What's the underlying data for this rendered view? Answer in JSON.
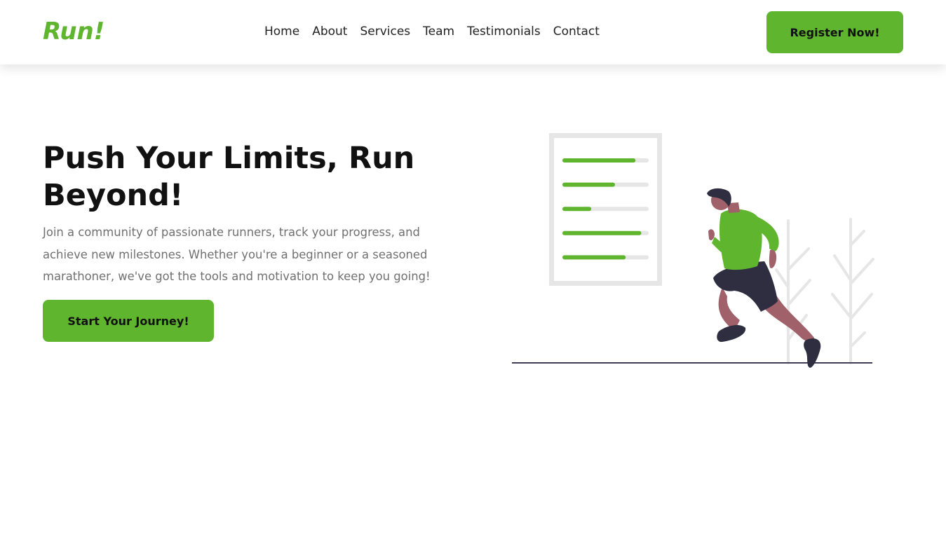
{
  "header": {
    "logo": "Run!",
    "nav": [
      "Home",
      "About",
      "Services",
      "Team",
      "Testimonials",
      "Contact"
    ],
    "register_label": "Register Now!"
  },
  "hero": {
    "title": "Push Your Limits, Run Beyond!",
    "description": "Join a community of passionate runners, track your progress, and achieve new milestones. Whether you're a beginner or a seasoned marathoner, we've got the tools and motivation to keep you going!",
    "cta_label": "Start Your Journey!"
  },
  "illustration": {
    "progress_levels": [
      0.84,
      0.59,
      0.3,
      0.91,
      0.72
    ],
    "icons": [
      "runner-illustration",
      "progress-clipboard-icon",
      "tree-icon"
    ]
  },
  "colors": {
    "accent": "#5fb52e",
    "text_dark": "#111111",
    "text_muted": "#707070",
    "skin": "#a0616a",
    "dark_clothing": "#2f2e41",
    "light_gray": "#e6e6e6"
  }
}
